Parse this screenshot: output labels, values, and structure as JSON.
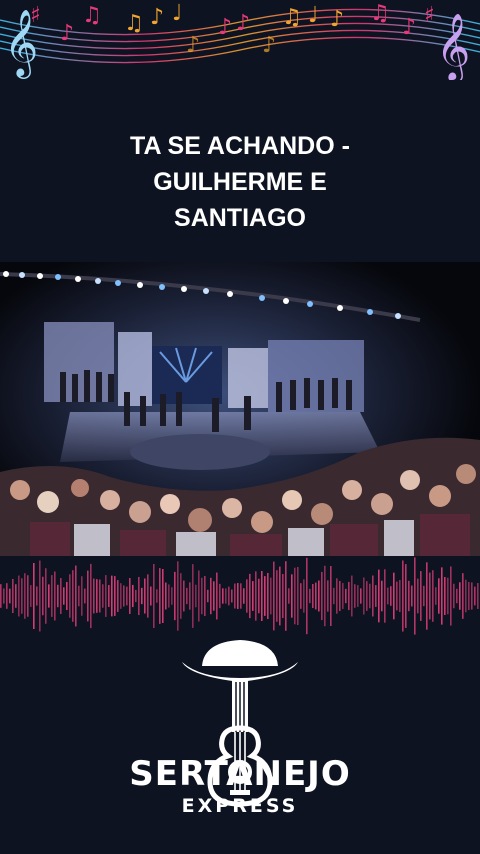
{
  "song": {
    "title": "TA SE ACHANDO -\nGUILHERME E\nSANTIAGO"
  },
  "brand": {
    "name": "SERTANEJO",
    "sub": "EXPRESS",
    "logo_icon": "cowboy-hat-guitar-icon"
  },
  "decor": {
    "top_banner_icon": "music-notes-banner-icon",
    "waveform_icon": "audio-waveform-icon",
    "waveform_color": "#e0407a",
    "note_colors": [
      "#3ec3f0",
      "#e63a7a",
      "#f0a530",
      "#9b59d0"
    ]
  },
  "video": {
    "scene": "concert-stage-photo"
  }
}
